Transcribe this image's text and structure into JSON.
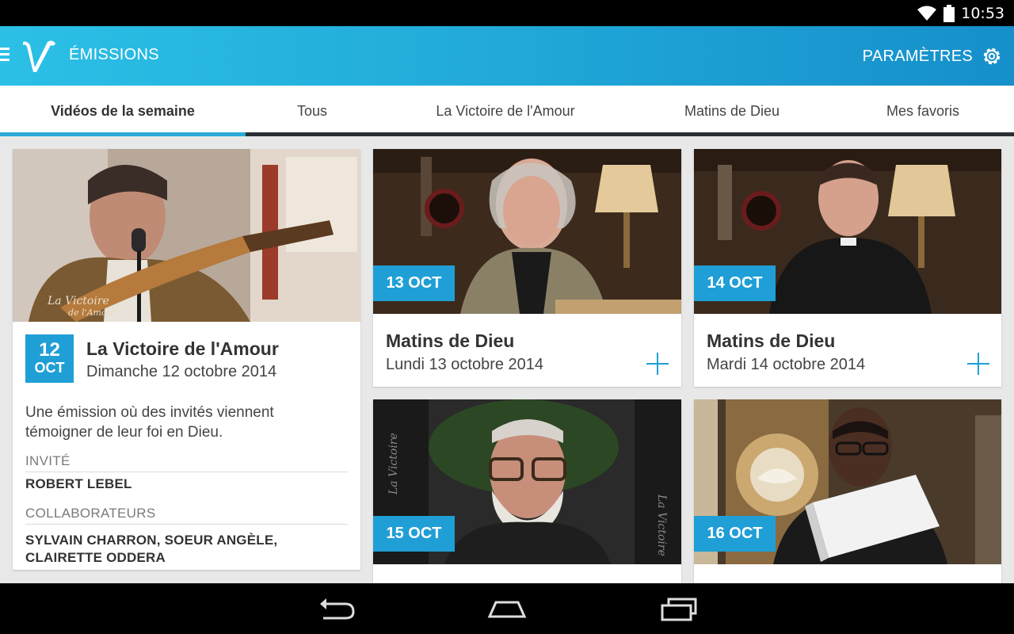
{
  "status_bar": {
    "time": "10:53",
    "icons": [
      "wifi-icon",
      "battery-icon"
    ]
  },
  "app_bar": {
    "logo_icon": "victoire-v-logo",
    "title": "ÉMISSIONS",
    "settings_label": "PARAMÈTRES",
    "settings_icon": "gear-icon",
    "menu_icon": "hamburger-icon"
  },
  "tabs": [
    {
      "label": "Vidéos de la semaine",
      "active": true
    },
    {
      "label": "Tous",
      "active": false
    },
    {
      "label": "La Victoire de l'Amour",
      "active": false
    },
    {
      "label": "Matins de Dieu",
      "active": false
    },
    {
      "label": "Mes favoris",
      "active": false
    }
  ],
  "featured": {
    "badge_day": "12",
    "badge_month": "OCT",
    "title": "La Victoire de l'Amour",
    "date": "Dimanche 12 octobre 2014",
    "description": "Une émission où des invités viennent témoigner de leur foi en Dieu.",
    "guest_label": "INVITÉ",
    "guest": "ROBERT LEBEL",
    "collaborators_label": "COLLABORATEURS",
    "collaborators": "SYLVAIN CHARRON, SOEUR ANGÈLE, CLAIRETTE ODDERA"
  },
  "cards": [
    {
      "badge": "13 OCT",
      "title": "Matins de Dieu",
      "date": "Lundi 13 octobre 2014"
    },
    {
      "badge": "14 OCT",
      "title": "Matins de Dieu",
      "date": "Mardi 14 octobre 2014"
    },
    {
      "badge": "15 OCT",
      "title": "",
      "date": ""
    },
    {
      "badge": "16 OCT",
      "title": "",
      "date": ""
    }
  ],
  "colors": {
    "accent": "#1f9fd6",
    "app_bar": "#22aedc",
    "tab_track": "#2a2f33",
    "background": "#e8e8e8"
  },
  "nav_bar": {
    "icons": [
      "back-icon",
      "home-icon",
      "recent-apps-icon"
    ]
  }
}
